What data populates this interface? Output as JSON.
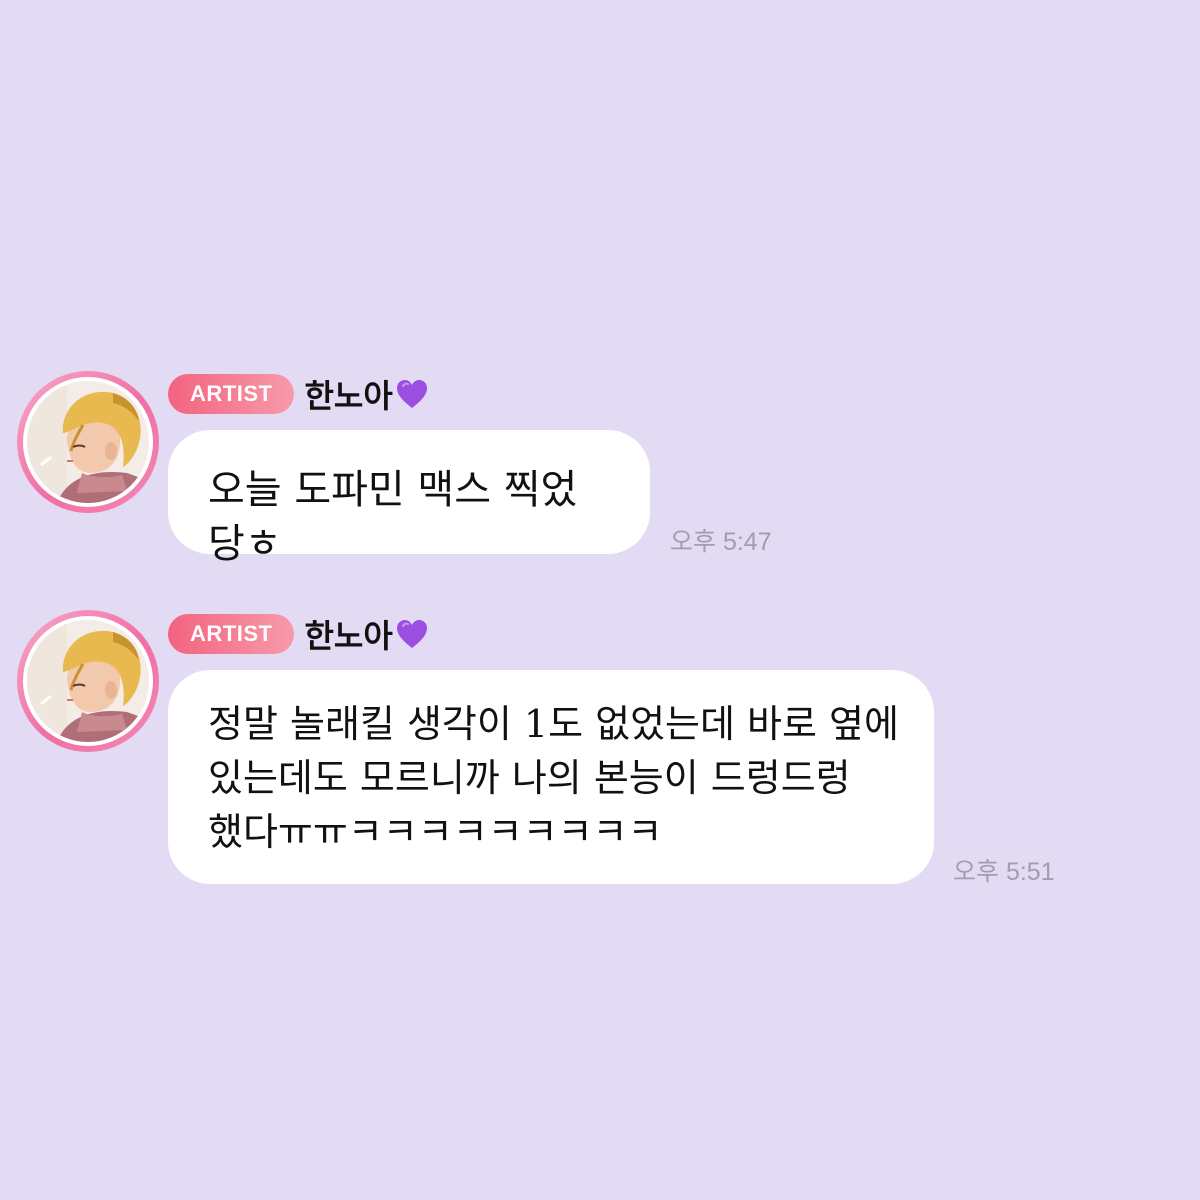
{
  "colors": {
    "background": "#e3daf3",
    "bubble": "#ffffff",
    "badge_start": "#f2647f",
    "badge_end": "#f79aaa",
    "avatar_ring": "#f06fa2",
    "timestamp": "#a39caf",
    "heart": "#9b4fe0"
  },
  "messages": [
    {
      "badge": "ARTIST",
      "sender": "한노아",
      "sender_icon": "purple-heart-icon",
      "text": "오늘 도파민 맥스 찍었당ㅎ",
      "time": "오후 5:47"
    },
    {
      "badge": "ARTIST",
      "sender": "한노아",
      "sender_icon": "purple-heart-icon",
      "text": "정말 놀래킬 생각이 1도 없었는데 바로 옆에\n있는데도 모르니까 나의 본능이 드렁드렁\n했다ㅠㅠㅋㅋㅋㅋㅋㅋㅋㅋㅋ",
      "time": "오후 5:51"
    }
  ]
}
